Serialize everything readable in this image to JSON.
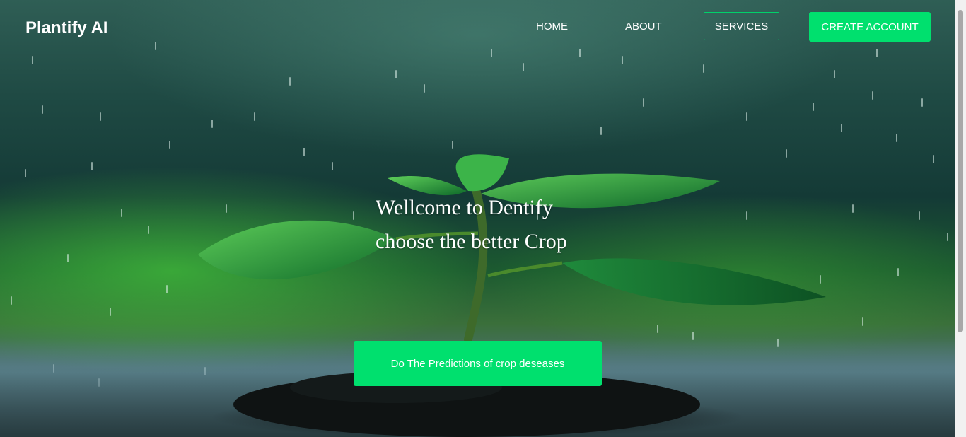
{
  "brand": {
    "name": "Plantify AI"
  },
  "nav": {
    "home": "HOME",
    "about": "ABOUT",
    "services": "SERVICES",
    "create_account": "CREATE ACCOUNT"
  },
  "hero": {
    "line1": "Wellcome to Dentify",
    "line2": "choose the better Crop",
    "cta": "Do The Predictions of crop deseases"
  },
  "colors": {
    "accent": "#00e06e",
    "accent_border": "#00d26a",
    "text": "#ffffff"
  }
}
